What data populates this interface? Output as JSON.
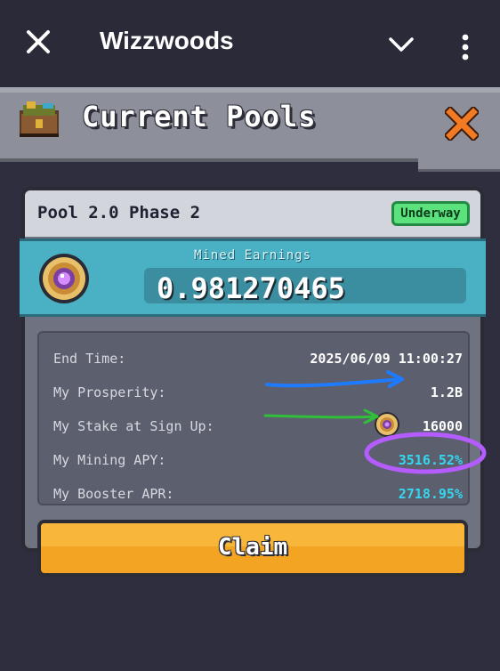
{
  "appbar": {
    "title": "Wizzwoods",
    "icons": [
      "close-icon",
      "chevron-down-icon",
      "more-vert-icon"
    ]
  },
  "header": {
    "title": "Current Pools",
    "icons": [
      "treasure-chest-icon",
      "close-x-icon"
    ]
  },
  "pool": {
    "name": "Pool 2.0 Phase 2",
    "status": "Underway",
    "earnings_label": "Mined Earnings",
    "earnings_value": "0.981270465",
    "details": [
      {
        "label": "End Time:",
        "value": "2025/06/09 11:00:27"
      },
      {
        "label": "My Prosperity:",
        "value": "1.2B"
      },
      {
        "label": "My Stake at Sign Up:",
        "value": "16000"
      },
      {
        "label": "My Mining APY:",
        "value": "3516.52%"
      },
      {
        "label": "My Booster APR:",
        "value": "2718.95%"
      }
    ],
    "claim_label": "Claim"
  },
  "colors": {
    "accent_cyan": "#35d6ef",
    "status_green": "#5be27c",
    "claim_orange": "#f3a422",
    "close_orange": "#f27a22",
    "annotation_blue": "#1e7bff",
    "annotation_green": "#2fbf3a",
    "annotation_purple": "#b45cff"
  }
}
